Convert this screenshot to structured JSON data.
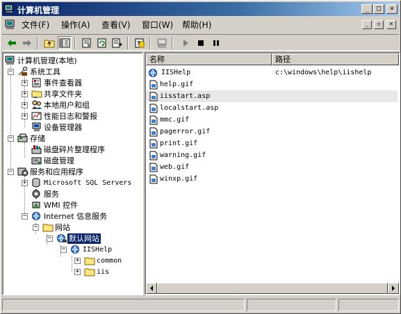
{
  "window": {
    "title": "计算机管理"
  },
  "menu": {
    "file": "文件(F)",
    "action": "操作(A)",
    "view": "查看(V)",
    "window": "窗口(W)",
    "help": "帮助(H)"
  },
  "tree": {
    "root": "计算机管理(本地)",
    "system_tools": "系统工具",
    "event_viewer": "事件查看器",
    "shared_folders": "共享文件夹",
    "local_users": "本地用户和组",
    "perf_logs": "性能日志和警报",
    "device_manager": "设备管理器",
    "storage": "存储",
    "defrag": "磁盘碎片整理程序",
    "disk_management": "磁盘管理",
    "services_apps": "服务和应用程序",
    "sql_servers": "Microsoft SQL Servers",
    "services": "服务",
    "wmi": "WMI 控件",
    "iis": "Internet 信息服务",
    "websites": "网站",
    "default_site": "默认网站",
    "iishelp": "IISHelp",
    "common": "common",
    "iis_folder": "iis"
  },
  "list": {
    "columns": {
      "name": "名称",
      "path": "路径"
    },
    "rows": [
      {
        "name": "IISHelp",
        "path": "c:\\windows\\help\\iishelp",
        "icon": "virtual-dir"
      },
      {
        "name": "help.gif",
        "path": "",
        "icon": "file"
      },
      {
        "name": "iisstart.asp",
        "path": "",
        "icon": "file"
      },
      {
        "name": "localstart.asp",
        "path": "",
        "icon": "file"
      },
      {
        "name": "mmc.gif",
        "path": "",
        "icon": "file"
      },
      {
        "name": "pagerror.gif",
        "path": "",
        "icon": "file"
      },
      {
        "name": "print.gif",
        "path": "",
        "icon": "file"
      },
      {
        "name": "warning.gif",
        "path": "",
        "icon": "file"
      },
      {
        "name": "web.gif",
        "path": "",
        "icon": "file"
      },
      {
        "name": "winxp.gif",
        "path": "",
        "icon": "file"
      }
    ]
  },
  "colors": {
    "title_start": "#0a246a",
    "title_end": "#a6caf0",
    "selection": "#0a246a",
    "face": "#d4d0c8"
  }
}
